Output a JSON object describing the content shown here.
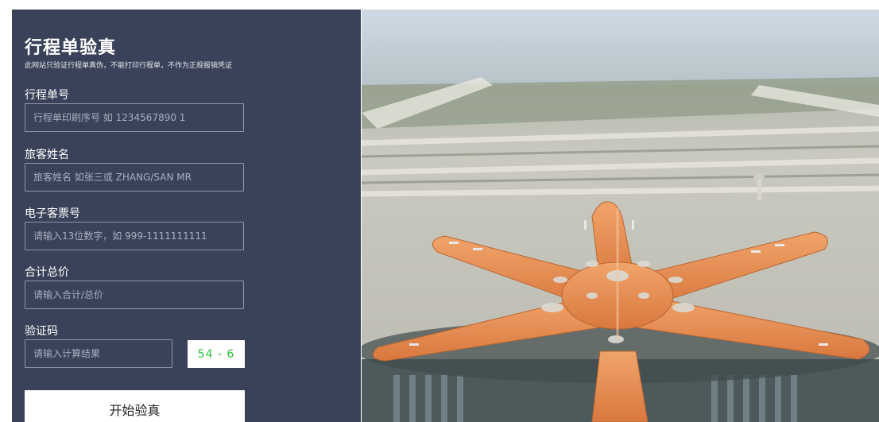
{
  "form": {
    "title": "行程单验真",
    "subtitle": "此网站只验证行程单真伪，不能打印行程单，不作为正规报销凭证",
    "fields": [
      {
        "label": "行程单号",
        "placeholder": "行程单印刷序号 如 1234567890 1",
        "value": ""
      },
      {
        "label": "旅客姓名",
        "placeholder": "旅客姓名 如张三或 ZHANG/SAN MR",
        "value": ""
      },
      {
        "label": "电子客票号",
        "placeholder": "请输入13位数字，如 999-1111111111",
        "value": ""
      },
      {
        "label": "合计总价",
        "placeholder": "请输入合计/总价",
        "value": ""
      }
    ],
    "captcha": {
      "label": "验证码",
      "placeholder": "请输入计算结果",
      "question": "54 - 6"
    },
    "submit_label": "开始验真"
  },
  "colors": {
    "panel_bg": "#3a4259",
    "captcha_text": "#27c43a"
  },
  "hero_image": {
    "icon": "airport-aerial-photo"
  }
}
